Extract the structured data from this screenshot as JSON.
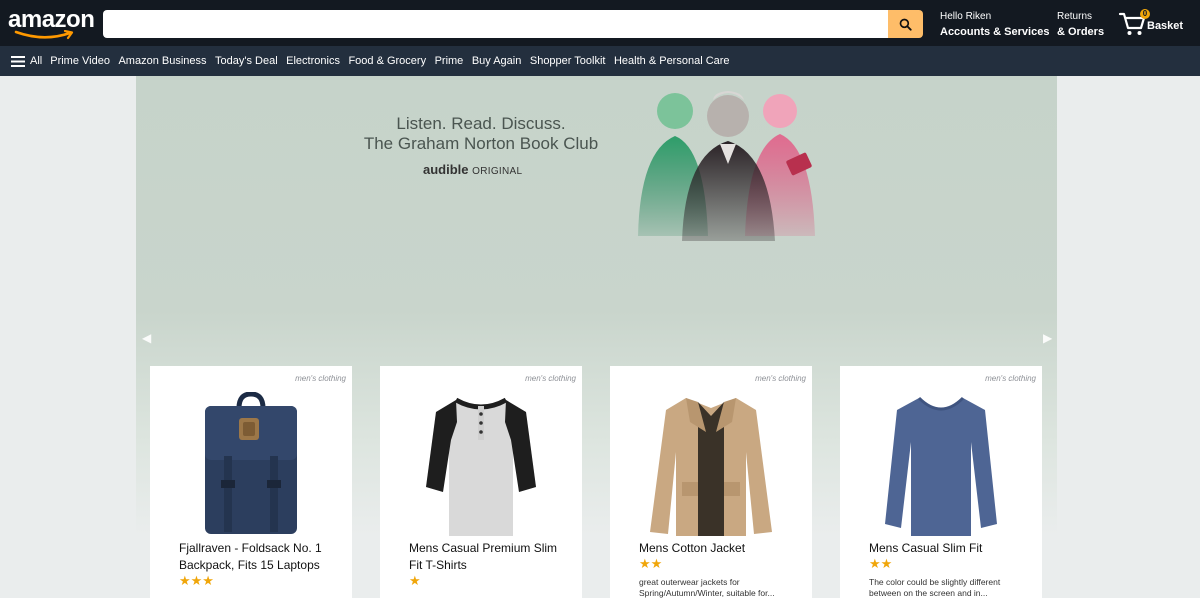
{
  "header": {
    "logo": "amazon",
    "search": {
      "value": "",
      "placeholder": ""
    },
    "account": {
      "line1": "Hello Riken",
      "line2": "Accounts & Services"
    },
    "orders": {
      "line1": "Returns",
      "line2": "& Orders"
    },
    "basket": {
      "count": "0",
      "label": "Basket"
    }
  },
  "subnav": {
    "all_label": "All",
    "items": [
      "Prime Video",
      "Amazon Business",
      "Today's Deal",
      "Electronics",
      "Food & Grocery",
      "Prime",
      "Buy Again",
      "Shopper Toolkit",
      "Health & Personal Care"
    ]
  },
  "banner": {
    "line1": "Listen. Read. Discuss.",
    "line2": "The Graham Norton Book Club",
    "brand_bold": "audible",
    "brand_sub": "ORIGINAL"
  },
  "products": [
    {
      "category": "men's clothing",
      "title": "Fjallraven - Foldsack No. 1 Backpack, Fits 15 Laptops",
      "rating": 3,
      "description": "",
      "icon": "backpack-icon"
    },
    {
      "category": "men's clothing",
      "title": "Mens Casual Premium Slim Fit T-Shirts",
      "rating": 1,
      "description": "",
      "icon": "tshirt-icon"
    },
    {
      "category": "men's clothing",
      "title": "Mens Cotton Jacket",
      "rating": 2,
      "description": "great outerwear jackets for Spring/Autumn/Winter, suitable for...",
      "icon": "jacket-icon"
    },
    {
      "category": "men's clothing",
      "title": "Mens Casual Slim Fit",
      "rating": 2,
      "description": "The color could be slightly different between on the screen and in...",
      "icon": "longsleeve-icon"
    }
  ],
  "colors": {
    "header_bg": "#131921",
    "subnav_bg": "#232f3e",
    "search_button": "#febd69",
    "star": "#f0a60a",
    "page_bg": "#eaeded"
  }
}
